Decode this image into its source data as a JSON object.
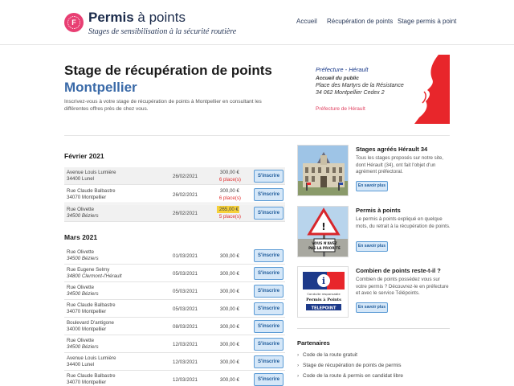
{
  "header": {
    "brand_bold": "Permis",
    "brand_rest": " à points",
    "brand_sub": "Stages de sensibilisation à la sécurité routière",
    "logo_letter": "F",
    "nav": [
      "Accueil",
      "Récupération de points",
      "Stage permis à point"
    ]
  },
  "hero": {
    "title": "Stage de récupération de points",
    "city": "Montpellier",
    "description": "Inscrivez-vous à votre stage de récupération de points à Montpellier en consultant les différentes offres près de chez vous."
  },
  "prefecture": {
    "title": "Préfecture - Hérault",
    "accueil": "Accueil du public",
    "addr1": "Place des Martyrs de la Résistance",
    "addr2": "34 062 Montpellier Cedex 2",
    "link": "Préfecture de Hérault"
  },
  "listings": {
    "feb_label": "Février 2021",
    "mar_label": "Mars 2021",
    "button_label": "S'inscrire",
    "feb": [
      {
        "addr1": "Avenue Louis Lumière",
        "addr2": "34400 Lunel",
        "date": "26/02/2021",
        "price": "300,00 €",
        "places": "6 place(s)"
      },
      {
        "addr1": "Rue Claude Balbastre",
        "addr2": "34070 Montpellier",
        "date": "26/02/2021",
        "price": "300,00 €",
        "places": "6 place(s)"
      },
      {
        "addr1": "Rue Olivette",
        "addr2": "34500 Béziers",
        "date": "26/02/2021",
        "price": "265,00 €",
        "places": "5 place(s)"
      }
    ],
    "mar": [
      {
        "addr1": "Rue Olivette",
        "addr2": "34500 Béziers",
        "date": "01/03/2021",
        "price": "300,00 €"
      },
      {
        "addr1": "Rue Eugene Selmy",
        "addr2": "34800 Clermont-l'Hérault",
        "date": "05/03/2021",
        "price": "300,00 €"
      },
      {
        "addr1": "Rue Olivette",
        "addr2": "34500 Béziers",
        "date": "05/03/2021",
        "price": "300,00 €"
      },
      {
        "addr1": "Rue Claude Balbastre",
        "addr2": "34070 Montpellier",
        "date": "05/03/2021",
        "price": "300,00 €"
      },
      {
        "addr1": "Boulevard D'antigone",
        "addr2": "34000 Montpellier",
        "date": "08/03/2021",
        "price": "300,00 €"
      },
      {
        "addr1": "Rue Olivette",
        "addr2": "34500 Béziers",
        "date": "12/03/2021",
        "price": "300,00 €"
      },
      {
        "addr1": "Avenue Louis Lumière",
        "addr2": "34400 Lunel",
        "date": "12/03/2021",
        "price": "300,00 €"
      },
      {
        "addr1": "Rue Claude Balbastre",
        "addr2": "34070 Montpellier",
        "date": "12/03/2021",
        "price": "300,00 €"
      }
    ]
  },
  "cards": {
    "more_label": "En savoir plus",
    "items": [
      {
        "title": "Stages agréés Hérault 34",
        "desc": "Tous les stages proposés sur notre site, dont Hérault (34), ont fait l'objet d'un agrément préfectoral.",
        "image": "prefecture-building-image"
      },
      {
        "title": "Permis à points",
        "desc": "Le permis à points expliqué en quelque mots, du retrait à la récupération de points.",
        "image": "road-sign-image",
        "sign_text": "VOUS N'AVEZ PAS LA PRIORITÉ"
      },
      {
        "title": "Combien de points reste-t-il ?",
        "desc": "Combien de points possédez vous sur votre permis ? Découvrez-le en préfecture et avec le service Télépoints.",
        "image": "telepoint-image",
        "img_line1": "Conduite responsable",
        "img_line2": "Permis à Points",
        "img_line3": "TELEPOINT"
      }
    ]
  },
  "partners": {
    "title": "Partenaires",
    "links": [
      "Code de la route gratuit",
      "Stage de récupération de points de permis",
      "Code de la route & permis en candidat libre"
    ]
  }
}
